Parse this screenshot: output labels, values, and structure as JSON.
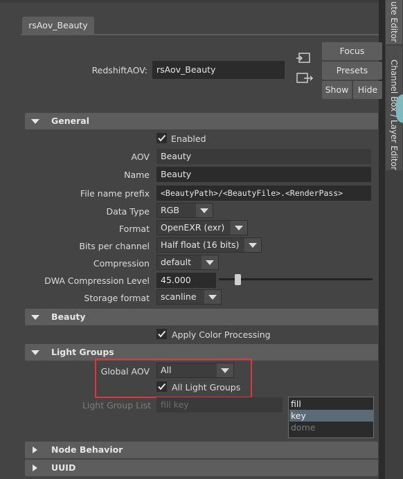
{
  "node_tab": "rsAov_Beauty",
  "node_row": {
    "label": "RedshiftAOV:",
    "value": "rsAov_Beauty",
    "focus_button": "Focus",
    "presets_button": "Presets",
    "show_button": "Show",
    "hide_button": "Hide"
  },
  "right_tabs": {
    "attribute_editor": "ute Editor",
    "channel_box": "Channel Box / Layer Editor"
  },
  "general": {
    "title": "General",
    "enabled_label": "Enabled",
    "enabled_checked": true,
    "aov_label": "AOV",
    "aov_value": "Beauty",
    "name_label": "Name",
    "name_value": "Beauty",
    "file_prefix_label": "File name prefix",
    "file_prefix_value": "<BeautyPath>/<BeautyFile>.<RenderPass>",
    "data_type_label": "Data Type",
    "data_type_value": "RGB",
    "format_label": "Format",
    "format_value": "OpenEXR (exr)",
    "bits_label": "Bits per channel",
    "bits_value": "Half float (16 bits)",
    "compression_label": "Compression",
    "compression_value": "default",
    "dwa_label": "DWA Compression Level",
    "dwa_value": "45.000",
    "storage_label": "Storage format",
    "storage_value": "scanline"
  },
  "beauty": {
    "title": "Beauty",
    "apply_color_label": "Apply Color Processing",
    "apply_color_checked": true
  },
  "light_groups": {
    "title": "Light Groups",
    "global_aov_label": "Global AOV",
    "global_aov_value": "All",
    "all_groups_label": "All Light Groups",
    "all_groups_checked": true,
    "list_label": "Light Group List",
    "list_field": "fill key",
    "items": [
      "fill",
      "key",
      "dome"
    ]
  },
  "node_behavior": {
    "title": "Node Behavior"
  },
  "uuid": {
    "title": "UUID"
  },
  "colors": {
    "highlight_box": "#e0383a",
    "selection": "#5a6b77",
    "accent_tab": "#7fb9bd"
  }
}
